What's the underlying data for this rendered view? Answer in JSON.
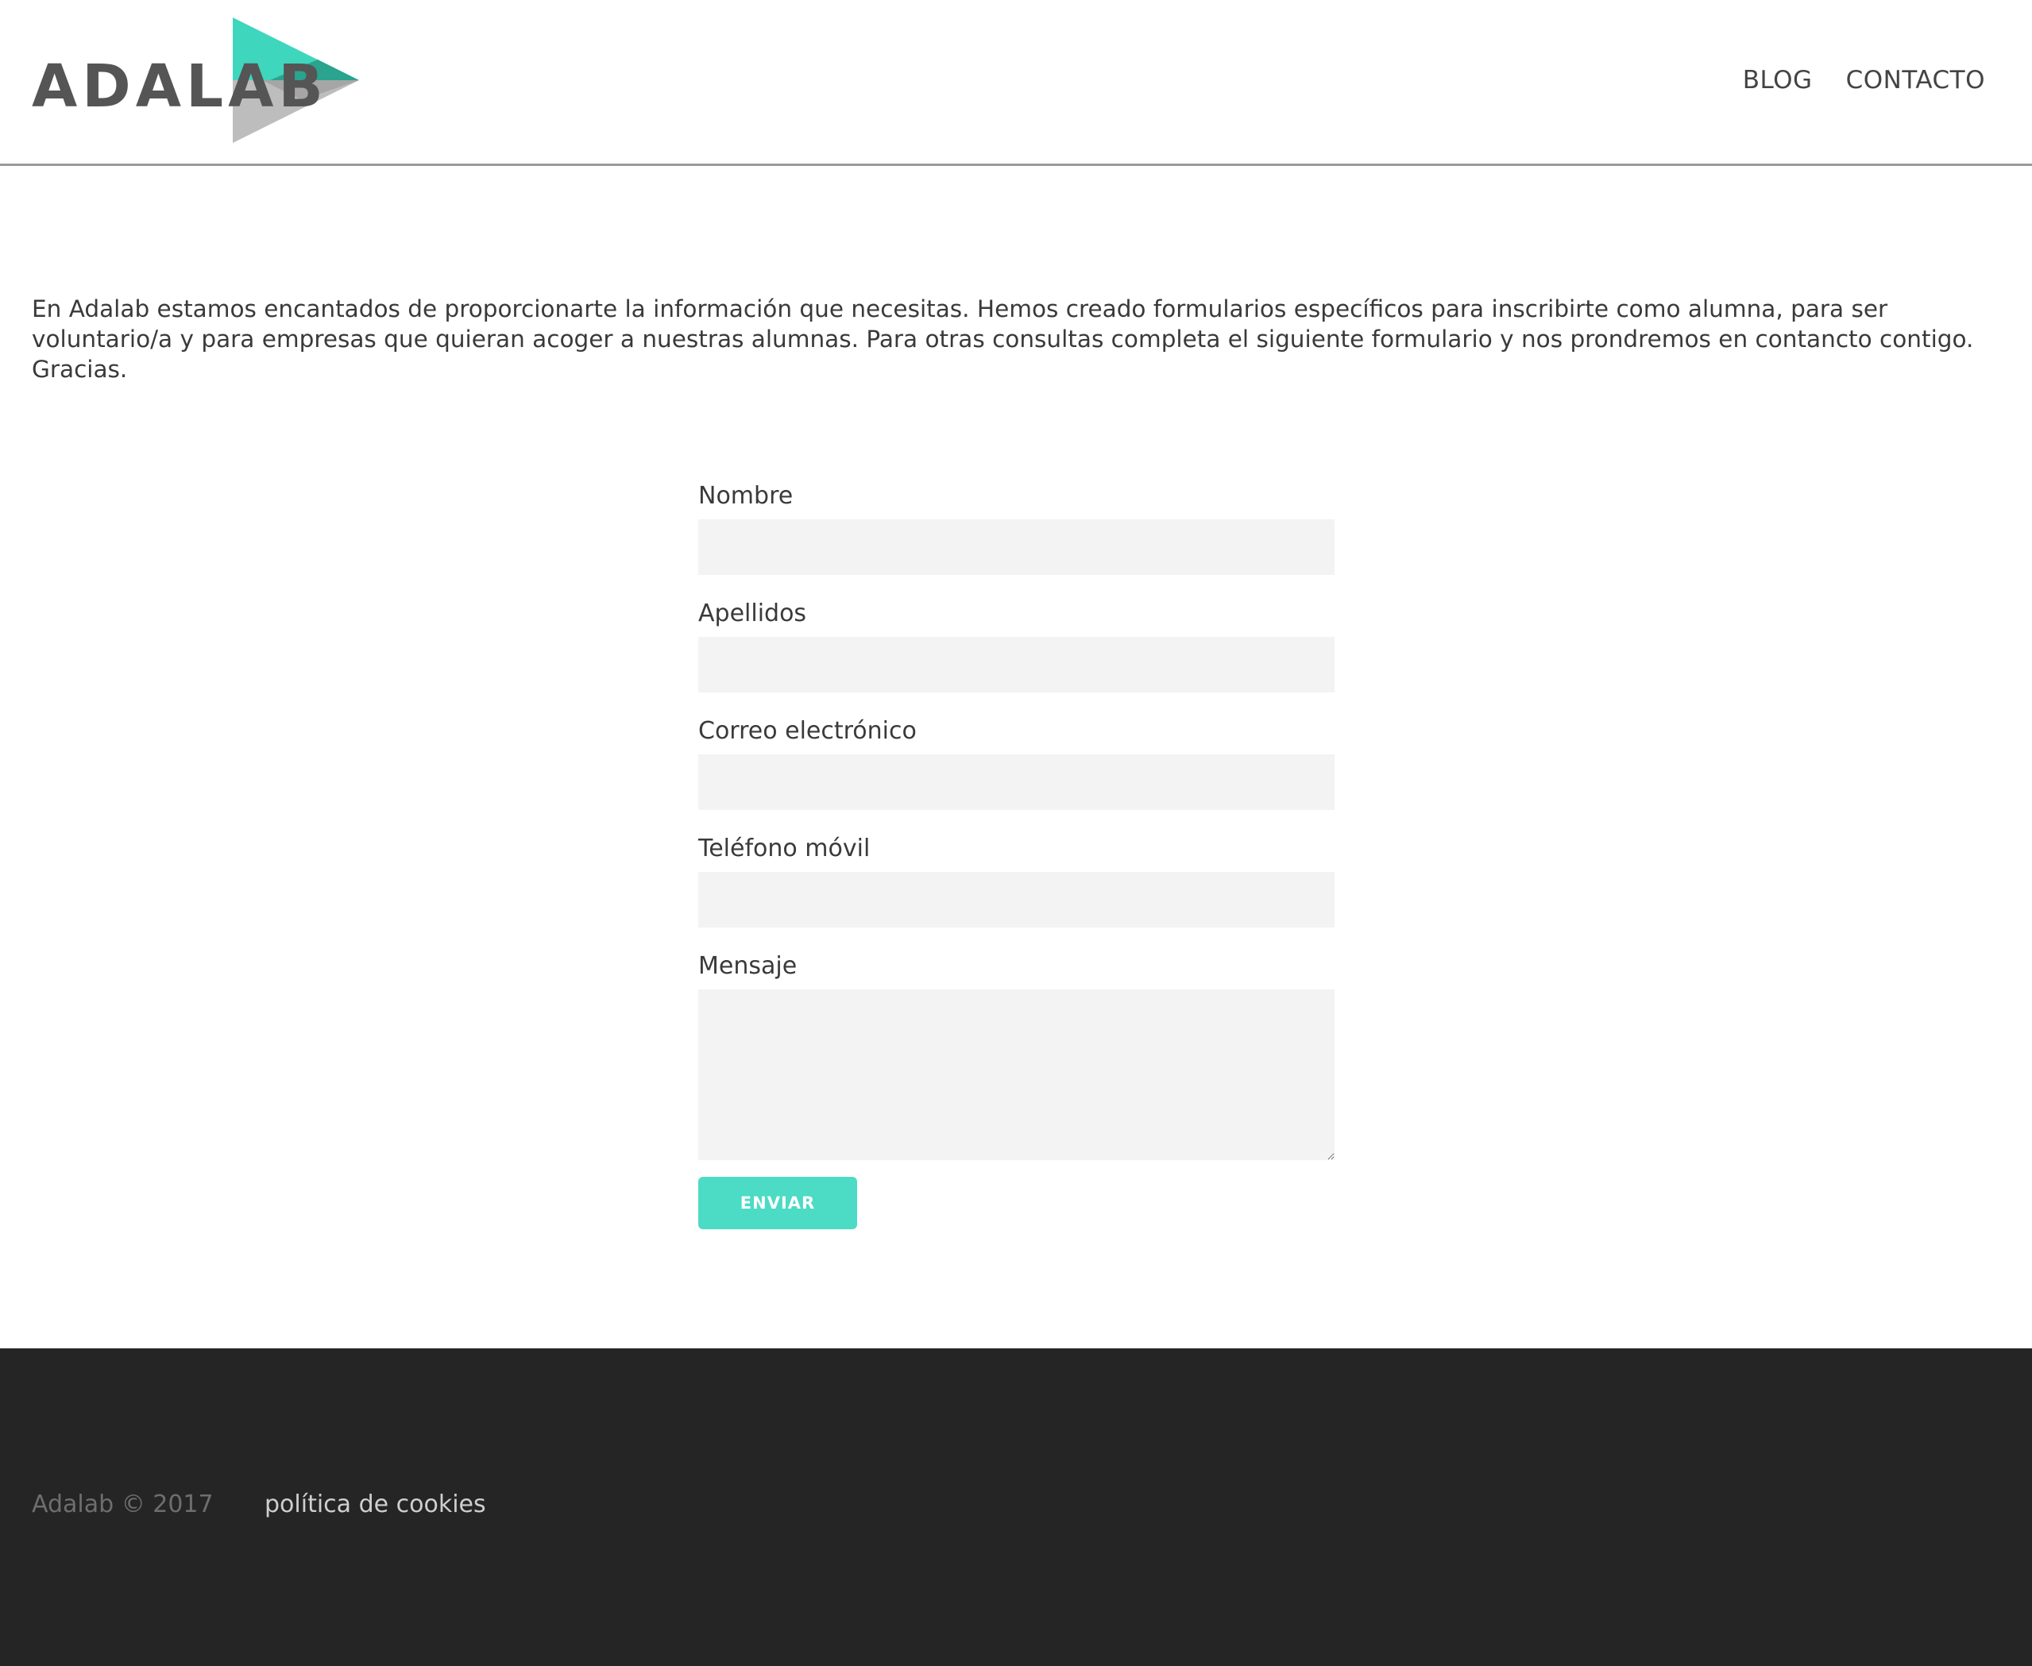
{
  "header": {
    "logo_text": "ADALAB",
    "nav": [
      {
        "label": "BLOG"
      },
      {
        "label": "CONTACTO"
      }
    ]
  },
  "intro": {
    "text": "En Adalab estamos encantados de proporcionarte la información que necesitas. Hemos creado formularios específicos para inscribirte como alumna, para ser voluntario/a y para empresas que quieran acoger a nuestras alumnas. Para otras consultas completa el siguiente formulario y nos prondremos en contancto contigo. Gracias."
  },
  "form": {
    "fields": [
      {
        "label": "Nombre",
        "value": ""
      },
      {
        "label": "Apellidos",
        "value": ""
      },
      {
        "label": "Correo electrónico",
        "value": ""
      },
      {
        "label": "Teléfono móvil",
        "value": ""
      },
      {
        "label": "Mensaje",
        "value": ""
      }
    ],
    "submit_label": "ENVIAR"
  },
  "footer": {
    "copyright": "Adalab © 2017",
    "cookies_link": "política de cookies"
  },
  "colors": {
    "accent": "#4cdbc4",
    "logo_teal": "#3fd6be",
    "logo_grey": "#bdbdbd",
    "footer_bg": "#252525",
    "input_bg": "#f3f3f3"
  }
}
